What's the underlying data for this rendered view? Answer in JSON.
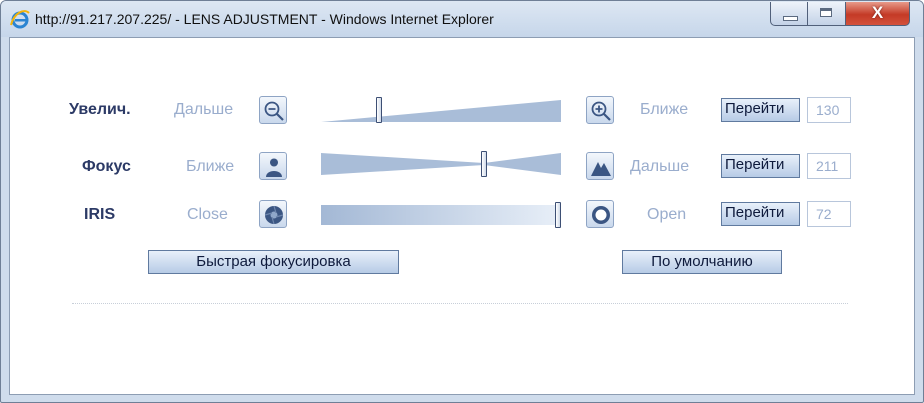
{
  "window": {
    "title": "http://91.217.207.225/ - LENS ADJUSTMENT - Windows Internet Explorer",
    "icons": {
      "app": "ie-logo-icon",
      "minimize": "minimize-icon",
      "maximize": "maximize-icon",
      "close": "close-icon"
    },
    "close_glyph": "X"
  },
  "rows": [
    {
      "key": "zoom",
      "label": "Увелич.",
      "left_text": "Дальше",
      "left_icon": "zoom-out-icon",
      "right_text": "Ближе",
      "right_icon": "zoom-in-icon",
      "go_label": "Перейти",
      "value": "130",
      "slider_shape": "wedge",
      "slider_position": 0.24
    },
    {
      "key": "focus",
      "label": "Фокус",
      "left_text": "Ближе",
      "left_icon": "person-icon",
      "right_text": "Дальше",
      "right_icon": "mountain-icon",
      "go_label": "Перейти",
      "value": "211",
      "slider_shape": "hourglass",
      "slider_position": 0.68
    },
    {
      "key": "iris",
      "label": "IRIS",
      "left_text": "Close",
      "left_icon": "iris-close-icon",
      "right_text": "Open",
      "right_icon": "iris-open-icon",
      "go_label": "Перейти",
      "value": "72",
      "slider_shape": "gradient",
      "slider_position": 1.0
    }
  ],
  "actions": {
    "quick_focus": "Быстрая фокусировка",
    "defaults": "По умолчанию"
  },
  "colors": {
    "accent_blue": "#a9bdd8",
    "label_navy": "#2c3a66",
    "hint_text": "#9aadcd"
  }
}
